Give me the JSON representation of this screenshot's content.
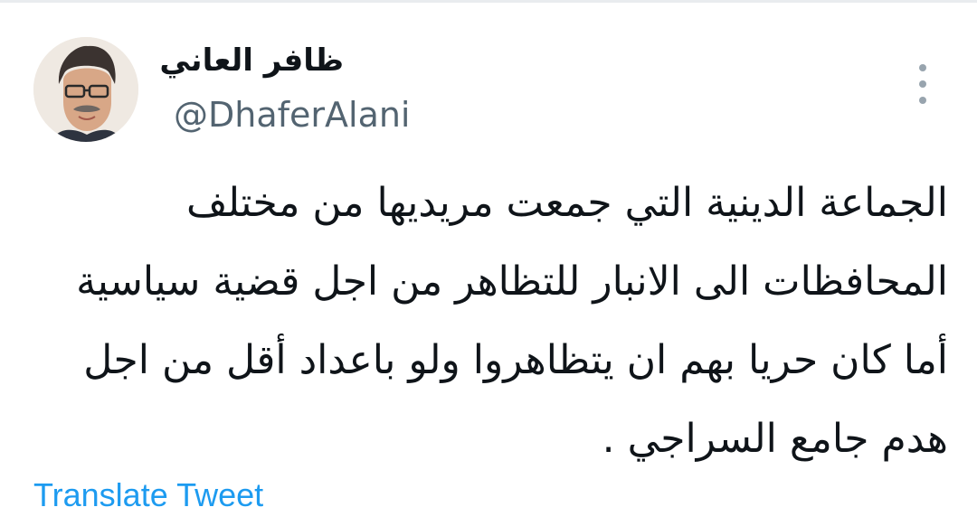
{
  "author": {
    "display_name": "ظافر العاني",
    "handle": "@DhaferAlani",
    "avatar_icon": "profile-photo"
  },
  "more_button": {
    "icon": "more-vertical-icon"
  },
  "tweet": {
    "lines": [
      "الجماعة الدينية التي جمعت مريديها من مختلف",
      "المحافظات الى الانبار للتظاهر من اجل قضية سياسية",
      "أما كان حريا بهم ان يتظاهروا ولو باعداد أقل من اجل",
      "هدم جامع السراجي ."
    ]
  },
  "translate": {
    "label": "Translate Tweet"
  },
  "colors": {
    "text": "#0f1419",
    "secondary": "#536471",
    "link": "#1d9bf0",
    "icon": "#98a4ae"
  }
}
